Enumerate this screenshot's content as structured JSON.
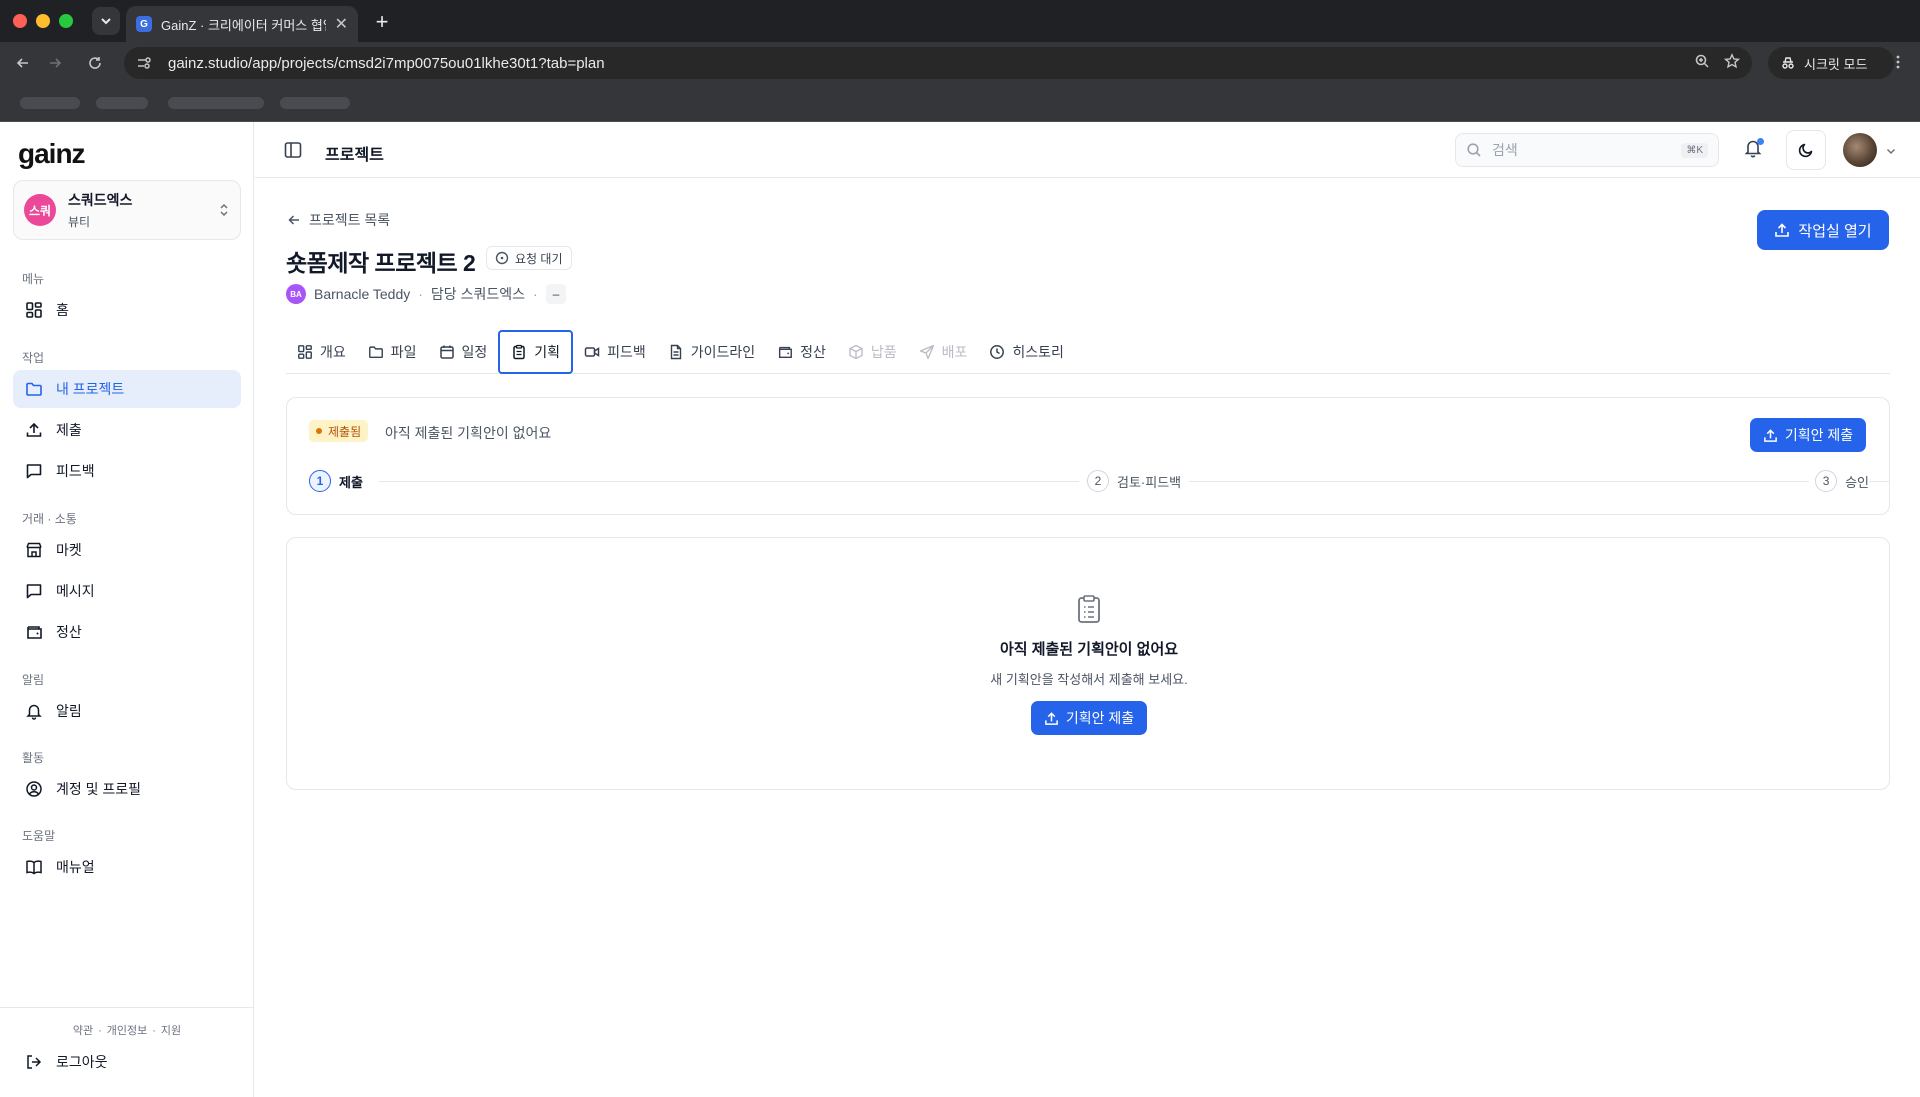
{
  "browser": {
    "tab_title": "GainZ · 크리에이터 커머스 협업 C",
    "favicon_letter": "G",
    "url": "gainz.studio/app/projects/cmsd2i7mp0075ou01lkhe30t1?tab=plan",
    "incognito_label": "시크릿 모드"
  },
  "sidebar": {
    "logo": "gainz",
    "workspace": {
      "avatar": "스쿼",
      "name": "스쿼드엑스",
      "category": "뷰티"
    },
    "sections": {
      "menu": "메뉴",
      "work": "작업",
      "trade": "거래 · 소통",
      "alerts": "알림",
      "activity": "활동",
      "help": "도움말"
    },
    "items": {
      "home": "홈",
      "my_projects": "내 프로젝트",
      "submit": "제출",
      "feedback": "피드백",
      "market": "마켓",
      "messages": "메시지",
      "settlement": "정산",
      "notifications": "알림",
      "account": "계정 및 프로필",
      "manual": "매뉴얼"
    },
    "footer": {
      "terms": "약관",
      "privacy": "개인정보",
      "support": "지원",
      "logout": "로그아웃"
    }
  },
  "topbar": {
    "title": "프로젝트",
    "search_placeholder": "검색",
    "search_shortcut": "⌘K"
  },
  "project": {
    "back_label": "프로젝트 목록",
    "title": "숏폼제작 프로젝트 2",
    "status": "요청 대기",
    "creator_initials": "BA",
    "creator_name": "Barnacle Teddy",
    "manager": "담당 스쿼드엑스",
    "extra": "–",
    "open_studio_label": "작업실 열기"
  },
  "tabs": [
    {
      "label": "개요"
    },
    {
      "label": "파일"
    },
    {
      "label": "일정"
    },
    {
      "label": "기획"
    },
    {
      "label": "피드백"
    },
    {
      "label": "가이드라인"
    },
    {
      "label": "정산"
    },
    {
      "label": "납품"
    },
    {
      "label": "배포"
    },
    {
      "label": "히스토리"
    }
  ],
  "plan": {
    "badge": "제출됨",
    "message": "아직 제출된 기획안이 없어요",
    "submit_label": "기획안 제출",
    "steps": [
      {
        "num": "1",
        "label": "제출"
      },
      {
        "num": "2",
        "label": "검토·피드백"
      },
      {
        "num": "3",
        "label": "승인"
      }
    ]
  },
  "empty": {
    "title": "아직 제출된 기획안이 없어요",
    "description": "새 기획안을 작성해서 제출해 보세요.",
    "button_label": "기획안 제출"
  },
  "colors": {
    "accent": "#2563eb",
    "active_nav_bg": "#e6edfb",
    "badge_bg": "#fef3c7",
    "badge_text": "#b45309"
  }
}
